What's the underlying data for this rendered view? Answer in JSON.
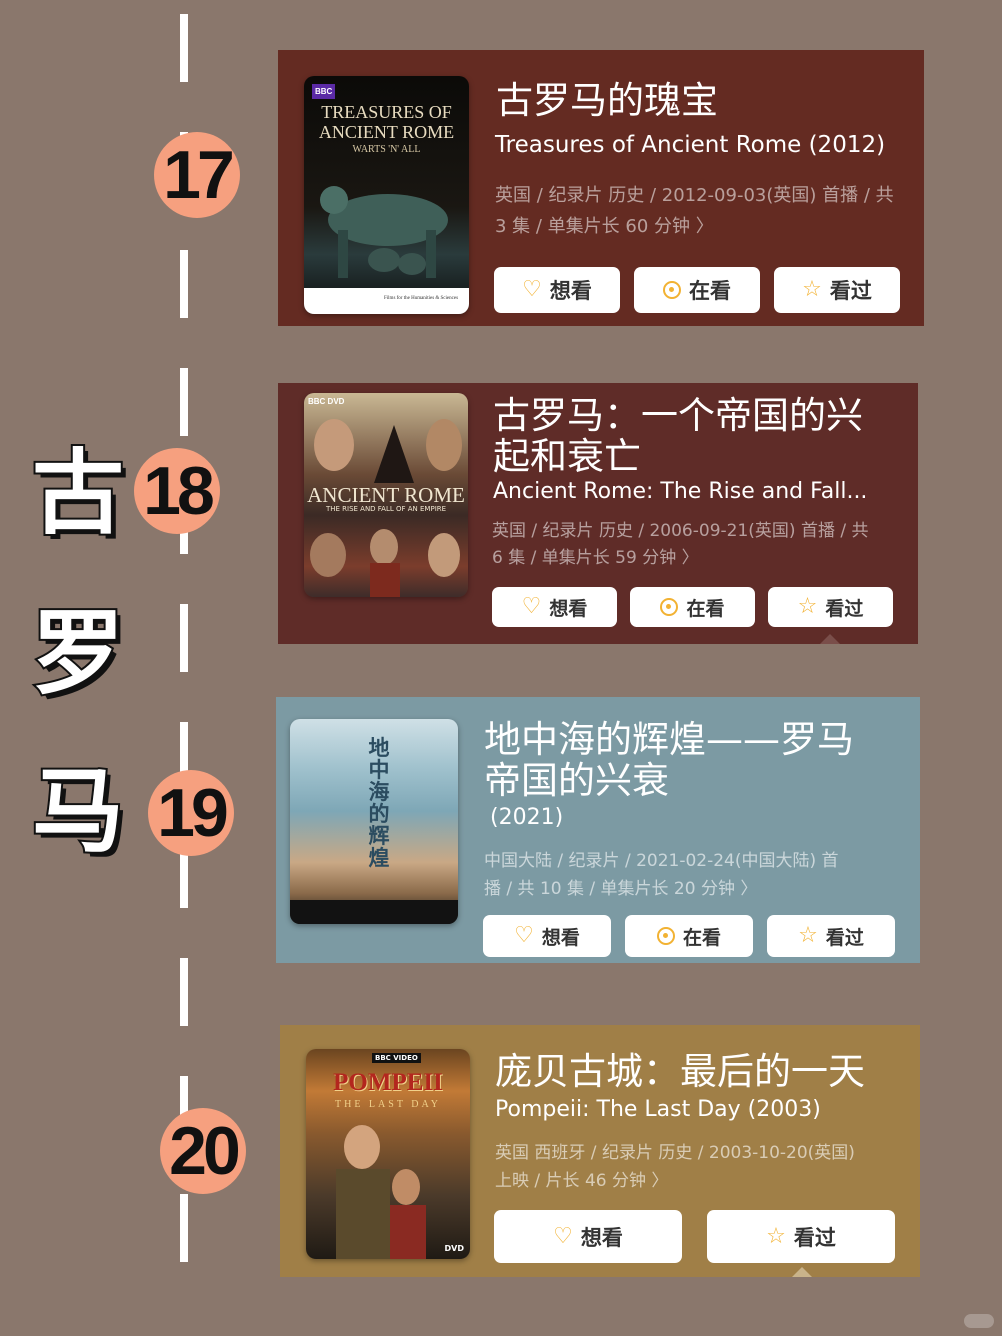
{
  "side_title": [
    "古",
    "罗",
    "马"
  ],
  "cards": [
    {
      "number": "17",
      "title": "古罗马的瑰宝",
      "subtitle": "Treasures of Ancient Rome (2012)",
      "meta_line1": "英国 / 纪录片 历史 / 2012-09-03(英国) 首播 / 共",
      "meta_line2": "3 集 / 单集片长 60 分钟 〉",
      "poster": {
        "brand": "BBC",
        "title_line1": "TREASURES OF",
        "title_line2": "ANCIENT ROME",
        "tagline": "WARTS 'N' ALL",
        "footer": "Films for the Humanities & Sciences"
      },
      "buttons": [
        {
          "label": "想看",
          "icon": "heart-plus-icon"
        },
        {
          "label": "在看",
          "icon": "target-dot-icon"
        },
        {
          "label": "看过",
          "icon": "star-icon"
        }
      ],
      "bg": "#642b22"
    },
    {
      "number": "18",
      "title_line1": "古罗马：一个帝国的兴",
      "title_line2": "起和衰亡",
      "subtitle": "Ancient Rome: The Rise and Fall...",
      "meta_line1": "英国 / 纪录片 历史 / 2006-09-21(英国) 首播 / 共",
      "meta_line2": "6 集 / 单集片长 59 分钟 〉",
      "poster": {
        "brand": "BBC DVD",
        "title": "ANCIENT ROME",
        "tagline": "THE RISE AND FALL OF AN EMPIRE"
      },
      "buttons": [
        {
          "label": "想看",
          "icon": "heart-plus-icon"
        },
        {
          "label": "在看",
          "icon": "target-dot-icon"
        },
        {
          "label": "看过",
          "icon": "star-icon"
        }
      ],
      "bg": "#5f2c28"
    },
    {
      "number": "19",
      "title_line1": "地中海的辉煌——罗马",
      "title_line2": "帝国的兴衰",
      "year": "(2021)",
      "meta_line1": "中国大陆 / 纪录片 / 2021-02-24(中国大陆) 首",
      "meta_line2": "播 / 共 10 集 / 单集片长 20 分钟 〉",
      "poster": {
        "title": "地中海的辉煌"
      },
      "buttons": [
        {
          "label": "想看",
          "icon": "heart-plus-icon"
        },
        {
          "label": "在看",
          "icon": "target-dot-icon"
        },
        {
          "label": "看过",
          "icon": "star-icon"
        }
      ],
      "bg": "#7c9aa3"
    },
    {
      "number": "20",
      "title": "庞贝古城：最后的一天",
      "subtitle": "Pompeii: The Last Day (2003)",
      "meta_line1": "英国 西班牙 / 纪录片 历史 / 2003-10-20(英国)",
      "meta_line2": "上映 / 片长 46 分钟 〉",
      "poster": {
        "brand": "BBC VIDEO",
        "title": "POMPEII",
        "tagline": "THE LAST DAY",
        "footer": "DVD"
      },
      "buttons": [
        {
          "label": "想看",
          "icon": "heart-plus-icon"
        },
        {
          "label": "看过",
          "icon": "star-icon"
        }
      ],
      "bg": "#a07f47"
    }
  ]
}
